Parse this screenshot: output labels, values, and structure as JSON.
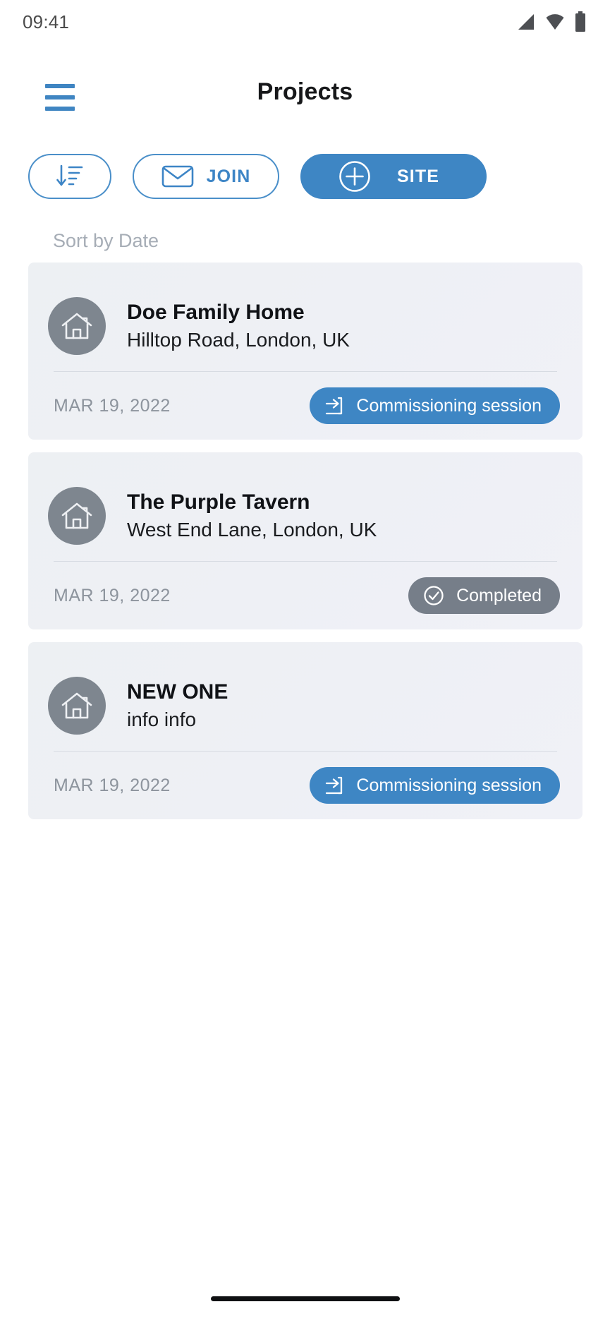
{
  "status_bar": {
    "time": "09:41",
    "icons": [
      "signal-icon",
      "wifi-icon",
      "battery-icon"
    ]
  },
  "app_bar": {
    "menu_label": "menu-icon",
    "title": "Projects"
  },
  "actions": {
    "sort": {
      "label": "",
      "icon": "sort-descending-icon"
    },
    "join": {
      "label": "JOIN",
      "icon": "envelope-icon"
    },
    "site": {
      "label": "SITE",
      "icon": "plus-circle-icon"
    }
  },
  "sort_label": "Sort by Date",
  "colors": {
    "accent_blue": "#3e86c4",
    "badge_gray": "#767e89",
    "avatar_gray": "#7e868f",
    "card_bg": "#eef0f4",
    "muted_text": "#a6adb6"
  },
  "projects": [
    {
      "title": "Doe Family Home",
      "address": "Hilltop Road, London, UK",
      "date": "MAR 19, 2022",
      "badge": {
        "text": "Commissioning session",
        "style": "blue",
        "icon": "enter-arrow-icon"
      },
      "avatar_icon": "house-icon"
    },
    {
      "title": "The Purple Tavern",
      "address": "West End Lane, London, UK",
      "date": "MAR 19, 2022",
      "badge": {
        "text": "Completed",
        "style": "gray",
        "icon": "check-circle-icon"
      },
      "avatar_icon": "house-icon"
    },
    {
      "title": "NEW ONE",
      "address": "info info",
      "date": "MAR 19, 2022",
      "badge": {
        "text": "Commissioning session",
        "style": "blue",
        "icon": "enter-arrow-icon"
      },
      "avatar_icon": "house-icon"
    }
  ]
}
